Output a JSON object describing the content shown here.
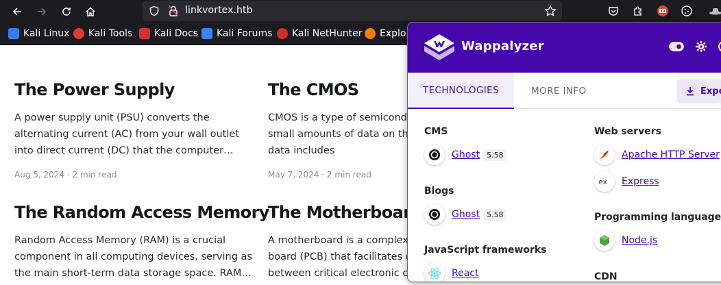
{
  "browser": {
    "url": "linkvortex.htb",
    "bookmarks": [
      {
        "label": "Kali Linux",
        "icon": "kali-dragon-icon",
        "color": "#367bf0"
      },
      {
        "label": "Kali Tools",
        "icon": "kali-tools-icon",
        "color": "#e53935"
      },
      {
        "label": "Kali Docs",
        "icon": "kali-docs-icon",
        "color": "#d32f2f"
      },
      {
        "label": "Kali Forums",
        "icon": "kali-forums-icon",
        "color": "#3b82f6"
      },
      {
        "label": "Kali NetHunter",
        "icon": "nethunter-icon",
        "color": "#d32f2f"
      },
      {
        "label": "Exploi",
        "icon": "exploit-db-icon",
        "color": "#f57c00"
      }
    ]
  },
  "posts": [
    {
      "title": "The Power Supply",
      "excerpt": "A power supply unit (PSU) converts the alternating current (AC) from your wall outlet into direct current (DC) that the computer compone…",
      "date": "Aug 5, 2024",
      "read": "2 min read"
    },
    {
      "title": "The CMOS",
      "excerpt": "CMOS is a type of semiconductor used to store small amounts of data on the motherboard. This data includes",
      "date": "May 7, 2024",
      "read": "2 min read"
    },
    {
      "title": "The Random Access Memory",
      "excerpt": "Random Access Memory (RAM) is a crucial component in all computing devices, serving as the main short-term data storage space. RAM…"
    },
    {
      "title": "The Motherboard",
      "excerpt": "A motherboard is a complex printed circuit board (PCB) that facilitates communication between critical electronic components"
    }
  ],
  "wappalyzer": {
    "title": "Wappalyzer",
    "accent": "#4608ad",
    "tabs": {
      "technologies": "TECHNOLOGIES",
      "more_info": "MORE INFO"
    },
    "export_label": "Expo",
    "left": [
      {
        "category": "CMS",
        "items": [
          {
            "name": "Ghost",
            "version": "5.58",
            "icon": "ghost-icon"
          }
        ]
      },
      {
        "category": "Blogs",
        "items": [
          {
            "name": "Ghost",
            "version": "5.58",
            "icon": "ghost-icon"
          }
        ]
      },
      {
        "category": "JavaScript frameworks",
        "items": [
          {
            "name": "React",
            "icon": "react-icon"
          }
        ]
      }
    ],
    "right": [
      {
        "category": "Web servers",
        "items": [
          {
            "name": "Apache HTTP Server",
            "icon": "apache-feather-icon"
          },
          {
            "name": "Express",
            "icon": "express-icon"
          }
        ]
      },
      {
        "category": "Programming languages",
        "items": [
          {
            "name": "Node.js",
            "icon": "nodejs-icon"
          }
        ]
      },
      {
        "category": "CDN",
        "items": []
      }
    ]
  }
}
